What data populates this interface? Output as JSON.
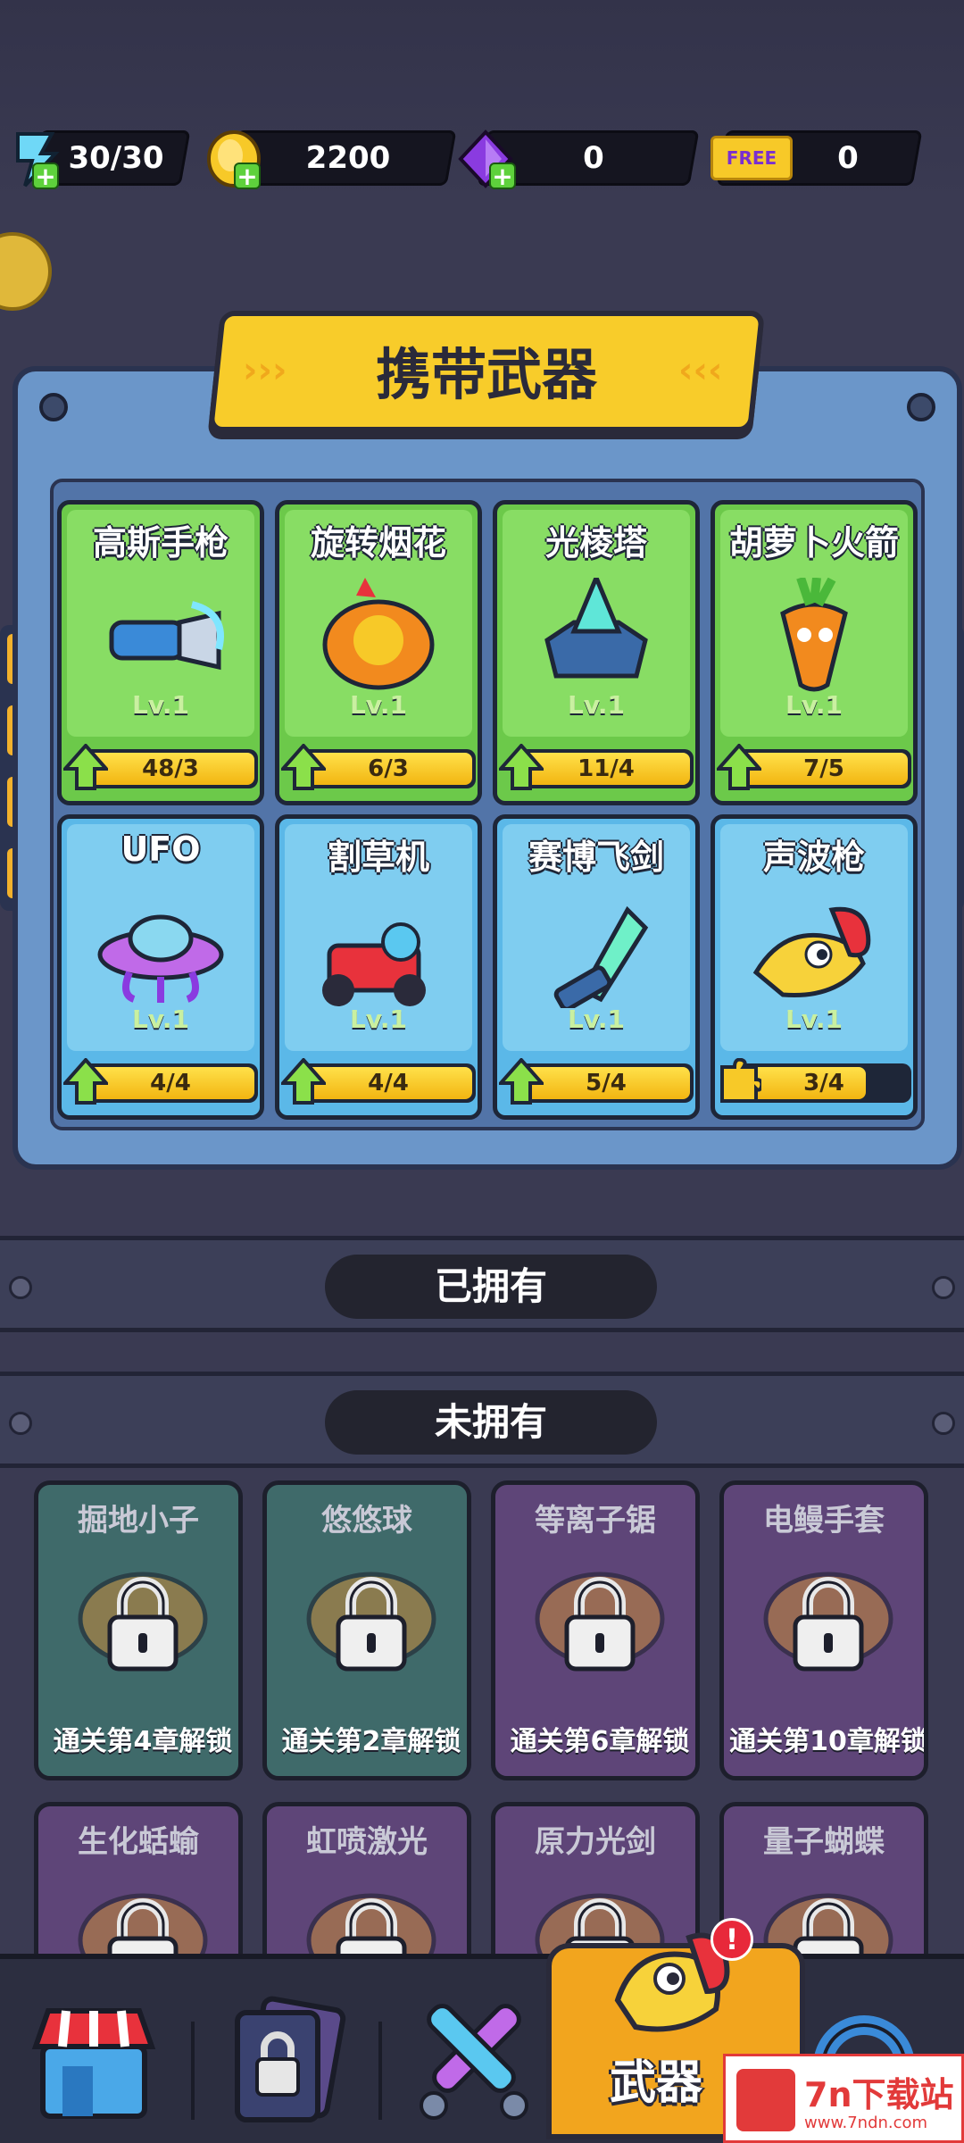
{
  "currency": {
    "energy": "30/30",
    "gold": "2200",
    "gems": "0",
    "free_tickets": "0",
    "free_label": "FREE"
  },
  "panel": {
    "title": "携带武器",
    "cards": [
      {
        "name": "高斯手枪",
        "level": "Lv.1",
        "progress": "48/3",
        "fill": 1.0,
        "color": "green",
        "upgrade": true
      },
      {
        "name": "旋转烟花",
        "level": "Lv.1",
        "progress": "6/3",
        "fill": 1.0,
        "color": "green",
        "upgrade": true
      },
      {
        "name": "光棱塔",
        "level": "Lv.1",
        "progress": "11/4",
        "fill": 1.0,
        "color": "green",
        "upgrade": true
      },
      {
        "name": "胡萝卜火箭",
        "level": "Lv.1",
        "progress": "7/5",
        "fill": 1.0,
        "color": "green",
        "upgrade": true
      },
      {
        "name": "UFO",
        "level": "Lv.1",
        "progress": "4/4",
        "fill": 1.0,
        "color": "blue",
        "upgrade": true
      },
      {
        "name": "割草机",
        "level": "Lv.1",
        "progress": "4/4",
        "fill": 1.0,
        "color": "blue",
        "upgrade": true
      },
      {
        "name": "赛博飞剑",
        "level": "Lv.1",
        "progress": "5/4",
        "fill": 1.0,
        "color": "blue",
        "upgrade": true
      },
      {
        "name": "声波枪",
        "level": "Lv.1",
        "progress": "3/4",
        "fill": 0.75,
        "color": "blue",
        "upgrade": false
      }
    ]
  },
  "sections": {
    "owned": "已拥有",
    "not_owned": "未拥有"
  },
  "locked": [
    {
      "name": "掘地小子",
      "hint": "通关第4章解锁",
      "color": "teal"
    },
    {
      "name": "悠悠球",
      "hint": "通关第2章解锁",
      "color": "teal"
    },
    {
      "name": "等离子锯",
      "hint": "通关第6章解锁",
      "color": "purple"
    },
    {
      "name": "电鳗手套",
      "hint": "通关第10章解锁",
      "color": "purple"
    },
    {
      "name": "生化蛞蝓",
      "hint": "",
      "color": "purple"
    },
    {
      "name": "虹喷激光",
      "hint": "",
      "color": "purple"
    },
    {
      "name": "原力光剑",
      "hint": "",
      "color": "purple"
    },
    {
      "name": "量子蝴蝶",
      "hint": "",
      "color": "purple"
    }
  ],
  "nav": {
    "items": [
      {
        "icon": "shop-icon"
      },
      {
        "icon": "locked-cards-icon"
      },
      {
        "icon": "crossed-swords-icon"
      },
      {
        "icon": "weapon-chicken-icon",
        "label": "武器",
        "active": true,
        "badge": "!"
      },
      {
        "icon": "ring-icon"
      }
    ]
  },
  "watermark": {
    "title": "7n下载站",
    "url": "www.7ndn.com"
  }
}
